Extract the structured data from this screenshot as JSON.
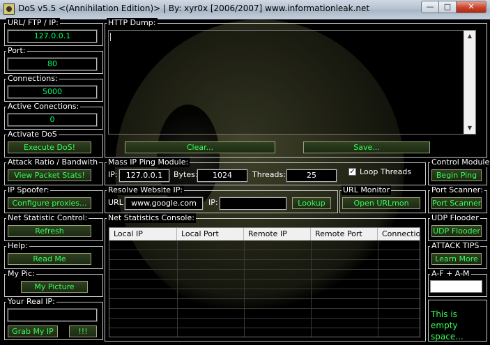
{
  "window": {
    "title": "DoS v5.5  <(Annihilation Edition)> |  By: xyr0x [2006/2007]   www.informationleak.net",
    "min_glyph": "—",
    "max_glyph": "□",
    "close_glyph": "✕"
  },
  "left": {
    "url_label": "URL/ FTP / IP:",
    "url_value": "127.0.0.1",
    "port_label": "Port:",
    "port_value": "80",
    "connections_label": "Connections:",
    "connections_value": "5000",
    "active_label": "Active Conections:",
    "active_value": "0",
    "activate_label": "Activate DoS",
    "execute_button": "Execute DoS!",
    "attack_label": "Attack Ratio / Bandwith",
    "packet_button": "View Packet Stats!",
    "spoofer_label": "IP Spoofer:",
    "proxies_button": "Configure proxies...",
    "netstat_label": "Net Statistic Control:",
    "refresh_button": "Refresh",
    "help_label": "Help:",
    "readme_button": "Read Me",
    "mypic_label": "My Pic:",
    "mypicture_button": "My Picture",
    "realip_label": "Your Real IP:",
    "realip_value": "",
    "grabip_button": "Grab My IP",
    "bang_button": "!!!"
  },
  "http": {
    "label": "HTTP Dump:",
    "clear_button": "Clear...",
    "save_button": "Save...",
    "up_arrow": "▲",
    "down_arrow": "▼"
  },
  "ping": {
    "label": "Mass IP Ping Module:",
    "ip_label": "IP:",
    "ip_value": "127.0.0.1",
    "bytes_label": "Bytes:",
    "bytes_value": "1024",
    "threads_label": "Threads:",
    "threads_value": "25",
    "loop_label": "Loop Threads",
    "loop_checked": true,
    "check_glyph": "✓"
  },
  "resolve": {
    "label": "Resolve Website IP:",
    "url_label": "URL:",
    "url_value": "www.google.com",
    "ip_label": "IP:",
    "ip_value": "",
    "lookup_button": "Lookup"
  },
  "urlmon": {
    "label": "URL Monitor",
    "button": "Open URLmon"
  },
  "console": {
    "label": "Net Statistics Console:",
    "columns": [
      "Local IP",
      "Local Port",
      "Remote IP",
      "Remote Port",
      "Connection"
    ]
  },
  "right": {
    "control_label": "Control Module:",
    "ping_button": "Begin Ping",
    "portscan_label": "Port Scanner:",
    "portscan_button": "Port Scanner",
    "udp_label": "UDP Flooder",
    "udp_button": "UDP Flooder",
    "tips_label": "ATTACK TIPS",
    "tips_button": "Learn More",
    "af_label": "A-F + A-M",
    "empty_text": "This is empty space..."
  }
}
